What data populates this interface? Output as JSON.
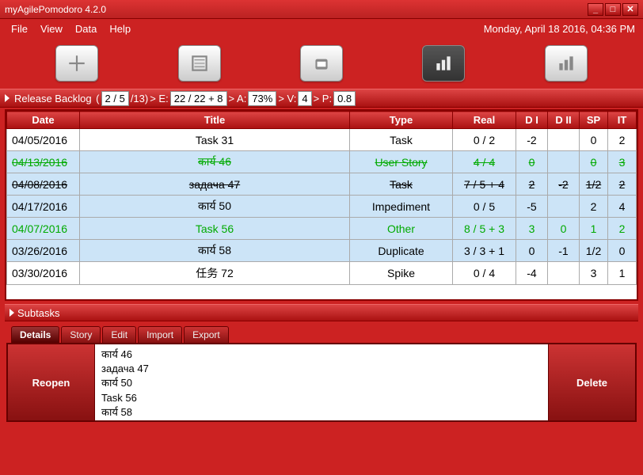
{
  "window": {
    "title": "myAgilePomodoro 4.2.0",
    "datetime": "Monday, April 18 2016, 04:36 PM"
  },
  "menu": {
    "file": "File",
    "view": "View",
    "data": "Data",
    "help": "Help"
  },
  "breadcrumb": {
    "label": "Release Backlog",
    "count_sel": "2 / 5",
    "count_total": "/13)",
    "e_label": "> E:",
    "e_val": "22 / 22 + 8",
    "a_label": "> A:",
    "a_val": "73%",
    "v_label": "> V:",
    "v_val": "4",
    "p_label": "> P:",
    "p_val": "0.8"
  },
  "columns": {
    "date": "Date",
    "title": "Title",
    "type": "Type",
    "real": "Real",
    "d1": "D I",
    "d2": "D II",
    "sp": "SP",
    "it": "IT"
  },
  "rows": [
    {
      "date": "04/05/2016",
      "title": "Task 31",
      "type": "Task",
      "real": "0 / 2",
      "d1": "-2",
      "d2": "",
      "sp": "0",
      "it": "2",
      "sel": false,
      "strike": false,
      "green": false
    },
    {
      "date": "04/13/2016",
      "title": "कार्य 46",
      "type": "User Story",
      "real": "4 / 4",
      "d1": "0",
      "d2": "",
      "sp": "0",
      "it": "3",
      "sel": true,
      "strike": true,
      "green": true
    },
    {
      "date": "04/08/2016",
      "title": "задача 47",
      "type": "Task",
      "real": "7 / 5 + 4",
      "d1": "2",
      "d2": "-2",
      "sp": "1/2",
      "it": "2",
      "sel": true,
      "strike": true,
      "green": false
    },
    {
      "date": "04/17/2016",
      "title": "कार्य 50",
      "type": "Impediment",
      "real": "0 / 5",
      "d1": "-5",
      "d2": "",
      "sp": "2",
      "it": "4",
      "sel": true,
      "strike": false,
      "green": false
    },
    {
      "date": "04/07/2016",
      "title": "Task 56",
      "type": "Other",
      "real": "8 / 5 + 3",
      "d1": "3",
      "d2": "0",
      "sp": "1",
      "it": "2",
      "sel": true,
      "strike": false,
      "green": true
    },
    {
      "date": "03/26/2016",
      "title": "कार्य 58",
      "type": "Duplicate",
      "real": "3 / 3 + 1",
      "d1": "0",
      "d2": "-1",
      "sp": "1/2",
      "it": "0",
      "sel": true,
      "strike": false,
      "green": false
    },
    {
      "date": "03/30/2016",
      "title": "任务 72",
      "type": "Spike",
      "real": "0 / 4",
      "d1": "-4",
      "d2": "",
      "sp": "3",
      "it": "1",
      "sel": false,
      "strike": false,
      "green": false
    }
  ],
  "subtasks": {
    "header": "Subtasks"
  },
  "tabs": {
    "details": "Details",
    "story": "Story",
    "edit": "Edit",
    "import": "Import",
    "export": "Export"
  },
  "buttons": {
    "reopen": "Reopen",
    "delete": "Delete"
  },
  "list": [
    "कार्य 46",
    "задача 47",
    "कार्य 50",
    "Task 56",
    "कार्य 58"
  ]
}
